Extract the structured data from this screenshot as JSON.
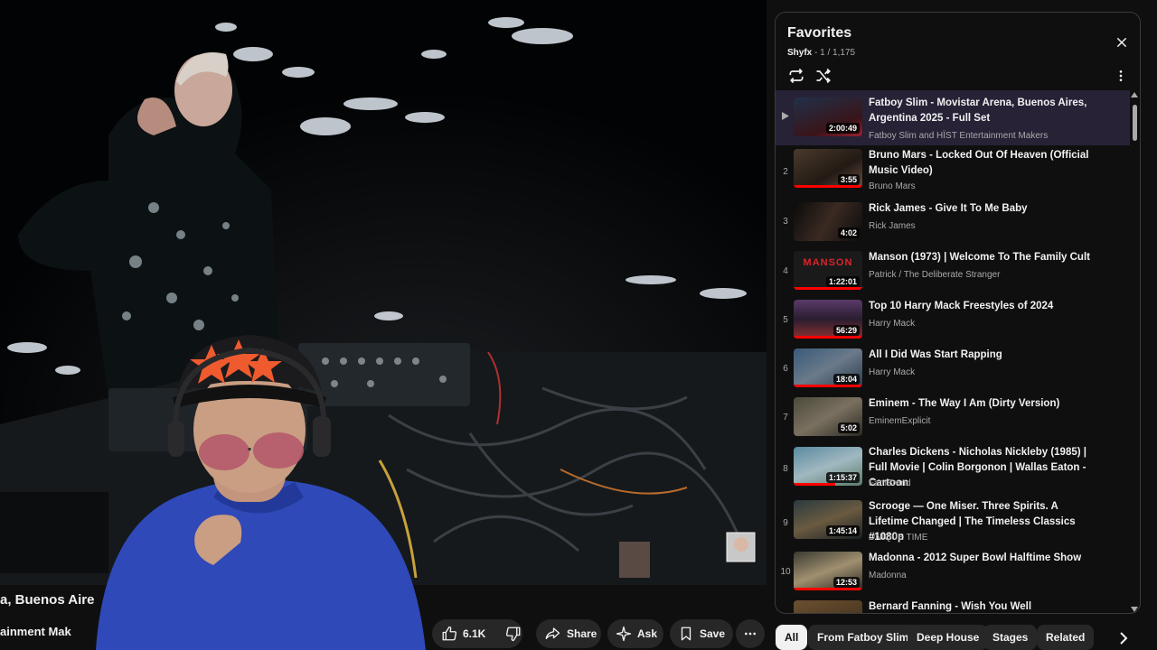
{
  "player": {
    "title_partial": "a, Buenos Aire",
    "channel_partial": "ainment Mak"
  },
  "actions": {
    "like_count": "6.1K",
    "share_label": "Share",
    "ask_label": "Ask",
    "save_label": "Save"
  },
  "playlist": {
    "title": "Favorites",
    "owner": "Shyfx",
    "position": "- 1 / 1,175",
    "items": [
      {
        "index": "",
        "title": "Fatboy Slim - Movistar Arena, Buenos Aires, Argentina 2025 - Full Set",
        "channel": "Fatboy Slim and HÏST Entertainment Makers",
        "duration": "2:00:49",
        "active": true
      },
      {
        "index": "2",
        "title": "Bruno Mars - Locked Out Of Heaven (Official Music Video)",
        "channel": "Bruno Mars",
        "duration": "3:55"
      },
      {
        "index": "3",
        "title": "Rick James - Give It To Me Baby",
        "channel": "Rick James",
        "duration": "4:02"
      },
      {
        "index": "4",
        "title": "Manson (1973) | Welcome To The Family Cult",
        "channel": "Patrick / The Deliberate Stranger",
        "duration": "1:22:01",
        "thumb_text": "MANSON"
      },
      {
        "index": "5",
        "title": "Top 10 Harry Mack Freestyles of 2024",
        "channel": "Harry Mack",
        "duration": "56:29"
      },
      {
        "index": "6",
        "title": "All I Did Was Start Rapping",
        "channel": "Harry Mack",
        "duration": "18:04"
      },
      {
        "index": "7",
        "title": "Eminem - The Way I Am (Dirty Version)",
        "channel": "EminemExplicit",
        "duration": "5:02"
      },
      {
        "index": "8",
        "title": "Charles Dickens - Nicholas Nickleby (1985) | Full Movie | Colin Borgonon | Wallas Eaton - Cartoon",
        "channel": "FamBrand",
        "duration": "1:15:37"
      },
      {
        "index": "9",
        "title": "Scrooge — One Miser. Three Spirits. A Lifetime Changed | The Timeless Classics #1080p",
        "channel": "UNIQUE TIME",
        "duration": "1:45:14"
      },
      {
        "index": "10",
        "title": "Madonna - 2012 Super Bowl Halftime Show",
        "channel": "Madonna",
        "duration": "12:53"
      },
      {
        "index": "",
        "title": "Bernard Fanning - Wish You Well",
        "channel": "",
        "duration": ""
      }
    ]
  },
  "chips": [
    "All",
    "From Fatboy Slim",
    "Deep House",
    "Stages",
    "Related"
  ],
  "colors": {
    "background": "#0f0f0f",
    "active_row": "#272236",
    "progress": "#ff0000",
    "surface": "#272727"
  }
}
